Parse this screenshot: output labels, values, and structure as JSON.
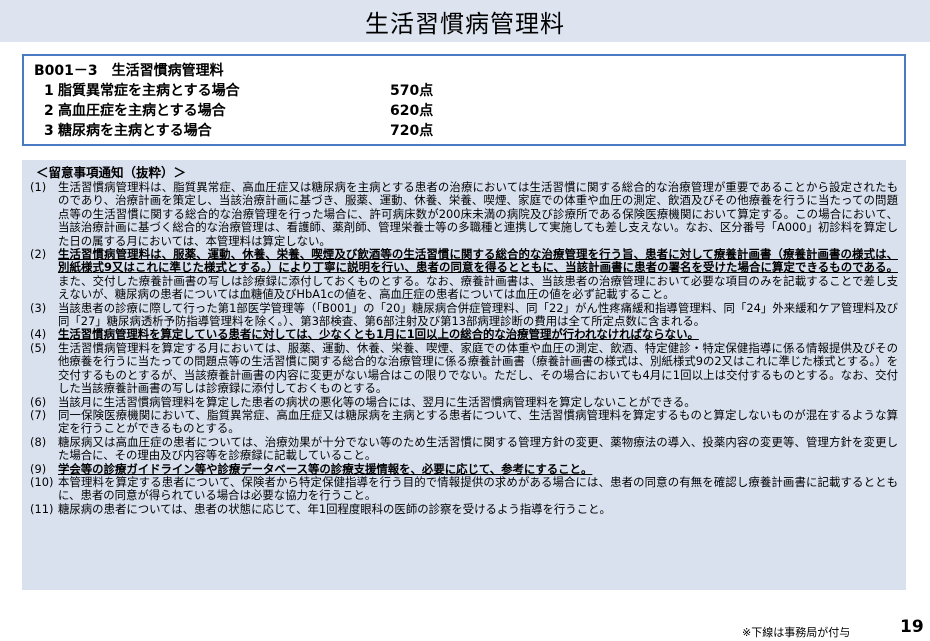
{
  "title": "生活習慣病管理料",
  "fee": {
    "code": "B001－3　生活習慣病管理料",
    "items": [
      {
        "no": "1",
        "label": "脂質異常症を主病とする場合",
        "points": "570点"
      },
      {
        "no": "2",
        "label": "高血圧症を主病とする場合",
        "points": "620点"
      },
      {
        "no": "3",
        "label": "糖尿病を主病とする場合",
        "points": "720点"
      }
    ]
  },
  "notes": {
    "heading": "＜留意事項通知（抜粋）＞",
    "items": [
      {
        "num": "(1)",
        "parts": [
          {
            "t": "生活習慣病管理料は、脂質異常症、高血圧症又は糖尿病を主病とする患者の治療においては生活習慣に関する総合的な治療管理が重要であることから設定されたものであり、治療計画を策定し、当該治療計画に基づき、服薬、運動、休養、栄養、喫煙、家庭での体重や血圧の測定、飲酒及びその他療養を行うに当たっての問題点等の生活習慣に関する総合的な治療管理を行った場合に、許可病床数が200床未満の病院及び診療所である保険医療機関において算定する。この場合において、当該治療計画に基づく総合的な治療管理は、看護師、薬剤師、管理栄養士等の多職種と連携して実施しても差し支えない。なお、区分番号「A000」初診料を算定した日の属する月においては、本管理料は算定しない。",
            "u": false
          }
        ]
      },
      {
        "num": "(2)",
        "parts": [
          {
            "t": "生活習慣病管理料は、服薬、運動、休養、栄養、喫煙及び飲酒等の生活習慣に関する総合的な治療管理を行う旨、患者に対して療養計画書（療養計画書の様式は、別紙様式9又はこれに準じた様式とする。）により丁寧に説明を行い、患者の同意を得るとともに、当該計画書に患者の署名を受けた場合に算定できるものである。",
            "u": true
          },
          {
            "t": "また、交付した療養計画書の写しは診療録に添付しておくものとする。なお、療養計画書は、当該患者の治療管理において必要な項目のみを記載することで差し支えないが、糖尿病の患者については血糖値及びHbA1cの値を、高血圧症の患者については血圧の値を必ず記載すること。",
            "u": false
          }
        ]
      },
      {
        "num": "(3)",
        "parts": [
          {
            "t": "当該患者の診療に際して行った第1部医学管理等（「B001」の「20」糖尿病合併症管理料、同「22」がん性疼痛緩和指導管理料、同「24」外来緩和ケア管理料及び同「27」糖尿病透析予防指導管理料を除く。）、第3部検査、第6部注射及び第13部病理診断の費用は全て所定点数に含まれる。",
            "u": false
          }
        ]
      },
      {
        "num": "(4)",
        "parts": [
          {
            "t": "生活習慣病管理料を算定している患者に対しては、少なくとも1月に1回以上の総合的な治療管理が行われなければならない。",
            "u": true
          }
        ]
      },
      {
        "num": "(5)",
        "parts": [
          {
            "t": "生活習慣病管理料を算定する月においては、服薬、運動、休養、栄養、喫煙、家庭での体重や血圧の測定、飲酒、特定健診・特定保健指導に係る情報提供及びその他療養を行うに当たっての問題点等の生活習慣に関する総合的な治療管理に係る療養計画書（療養計画書の様式は、別紙様式9の2又はこれに準じた様式とする。）を交付するものとするが、当該療養計画書の内容に変更がない場合はこの限りでない。ただし、その場合においても4月に1回以上は交付するものとする。なお、交付した当該療養計画書の写しは診療録に添付しておくものとする。",
            "u": false
          }
        ]
      },
      {
        "num": "(6)",
        "parts": [
          {
            "t": "当該月に生活習慣病管理料を算定した患者の病状の悪化等の場合には、翌月に生活習慣病管理料を算定しないことができる。",
            "u": false
          }
        ]
      },
      {
        "num": "(7)",
        "parts": [
          {
            "t": "同一保険医療機関において、脂質異常症、高血圧症又は糖尿病を主病とする患者について、生活習慣病管理料を算定するものと算定しないものが混在するような算定を行うことができるものとする。",
            "u": false
          }
        ]
      },
      {
        "num": "(8)",
        "parts": [
          {
            "t": "糖尿病又は高血圧症の患者については、治療効果が十分でない等のため生活習慣に関する管理方針の変更、薬物療法の導入、投薬内容の変更等、管理方針を変更した場合に、その理由及び内容等を診療録に記載していること。",
            "u": false
          }
        ]
      },
      {
        "num": "(9)",
        "parts": [
          {
            "t": "学会等の診療ガイドライン等や診療データベース等の診療支援情報を、必要に応じて、参考にすること。",
            "u": true
          }
        ]
      },
      {
        "num": "(10)",
        "parts": [
          {
            "t": "本管理料を算定する患者について、保険者から特定保健指導を行う目的で情報提供の求めがある場合には、患者の同意の有無を確認し療養計画書に記載するとともに、患者の同意が得られている場合は必要な協力を行うこと。",
            "u": false
          }
        ]
      },
      {
        "num": "(11)",
        "parts": [
          {
            "t": "糖尿病の患者については、患者の状態に応じて、年1回程度眼科の医師の診察を受けるよう指導を行うこと。",
            "u": false
          }
        ]
      }
    ]
  },
  "footer": {
    "note": "※下線は事務局が付与",
    "page": "19"
  }
}
